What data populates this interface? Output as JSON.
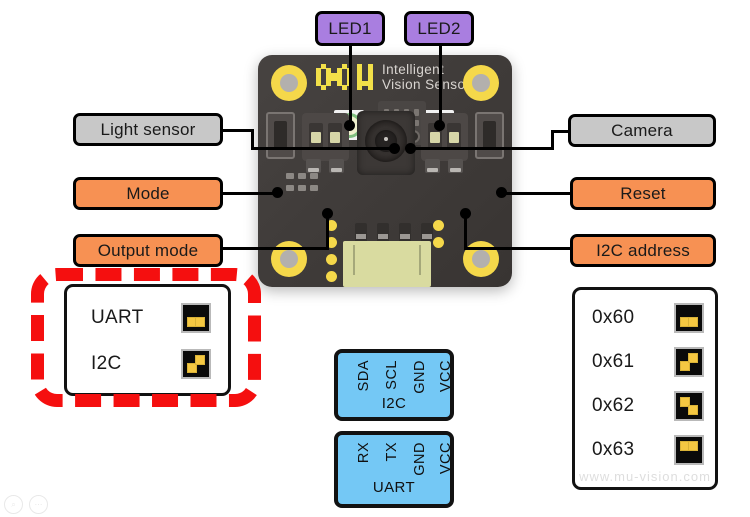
{
  "callouts": {
    "led1": {
      "label": "LED1",
      "color": "#a97ee0"
    },
    "led2": {
      "label": "LED2",
      "color": "#a97ee0"
    },
    "light_sensor": {
      "label": "Light sensor",
      "color": "#c8c8c8"
    },
    "camera": {
      "label": "Camera",
      "color": "#c8c8c8"
    },
    "mode": {
      "label": "Mode",
      "color": "#f79153"
    },
    "reset": {
      "label": "Reset",
      "color": "#f79153"
    },
    "output_mode": {
      "label": "Output mode",
      "color": "#f79153"
    },
    "i2c_address": {
      "label": "I2C address",
      "color": "#f79153"
    }
  },
  "board": {
    "logo": "MU",
    "subtitle_line1": "Intelligent",
    "subtitle_line2": "Vision Sensor"
  },
  "output_mode_panel": {
    "rows": [
      {
        "label": "UART",
        "left_switch": "down",
        "right_switch": "down"
      },
      {
        "label": "I2C",
        "left_switch": "down",
        "right_switch": "up"
      }
    ]
  },
  "i2c_address_panel": {
    "rows": [
      {
        "label": "0x60",
        "left_switch": "down",
        "right_switch": "down"
      },
      {
        "label": "0x61",
        "left_switch": "down",
        "right_switch": "up"
      },
      {
        "label": "0x62",
        "left_switch": "up",
        "right_switch": "down"
      },
      {
        "label": "0x63",
        "left_switch": "up",
        "right_switch": "up"
      }
    ],
    "watermark": "www.mu-vision.com"
  },
  "pinout_i2c": {
    "title": "I2C",
    "pins": [
      "SDA",
      "SCL",
      "GND",
      "VCC"
    ],
    "color": "#74c8f5"
  },
  "pinout_uart": {
    "title": "UART",
    "pins": [
      "RX",
      "TX",
      "GND",
      "VCC"
    ],
    "color": "#74c8f5"
  },
  "highlight": {
    "color": "#f50f0f",
    "target": "output_mode"
  },
  "watermark_icons": [
    {
      "name": "zoom-icon",
      "glyph": "⌕"
    },
    {
      "name": "more-icon",
      "glyph": "⋯"
    }
  ]
}
